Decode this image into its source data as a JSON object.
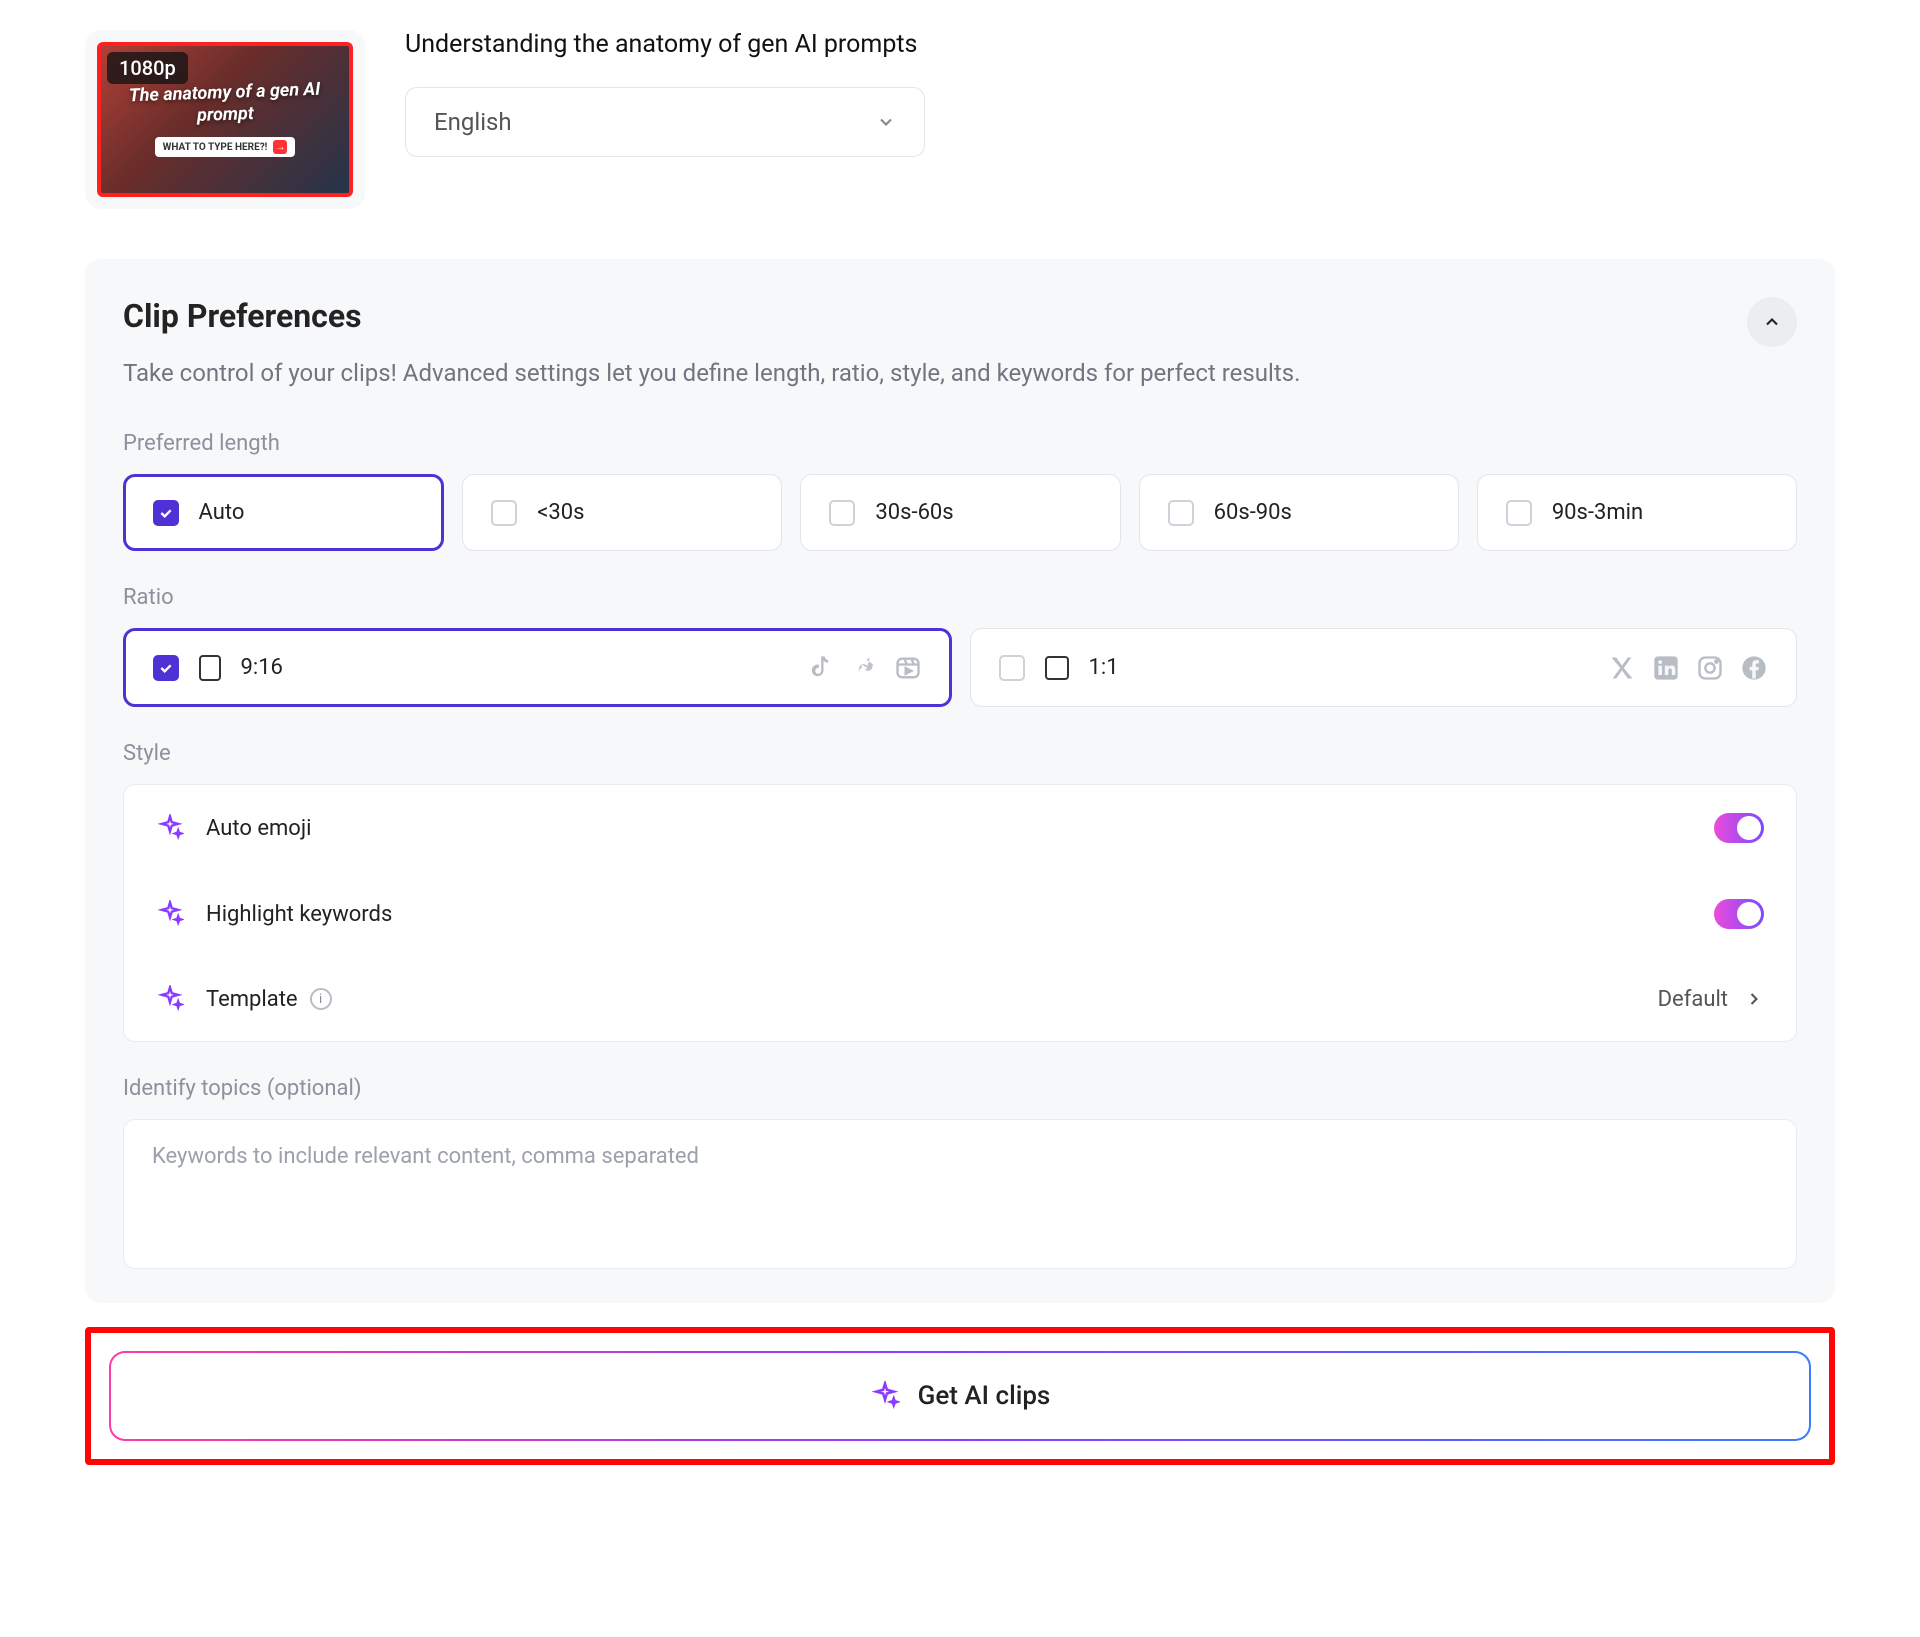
{
  "header": {
    "thumb_badge": "1080p",
    "thumb_text": "The anatomy of a gen AI prompt",
    "thumb_chip": "WHAT TO TYPE HERE?!",
    "video_title": "Understanding the anatomy of gen AI prompts",
    "language": "English"
  },
  "prefs": {
    "title": "Clip Preferences",
    "subtitle": "Take control of your clips! Advanced settings let you define length, ratio, style, and keywords for perfect results.",
    "length_label": "Preferred length",
    "length_options": [
      "Auto",
      "<30s",
      "30s-60s",
      "60s-90s",
      "90s-3min"
    ],
    "ratio_label": "Ratio",
    "ratio_options": [
      "9:16",
      "1:1"
    ],
    "style_label": "Style",
    "style": {
      "auto_emoji": "Auto emoji",
      "highlight": "Highlight keywords",
      "template": "Template",
      "template_value": "Default"
    },
    "topics_label": "Identify topics (optional)",
    "topics_placeholder": "Keywords to include relevant content, comma separated"
  },
  "cta": {
    "label": "Get AI clips"
  }
}
